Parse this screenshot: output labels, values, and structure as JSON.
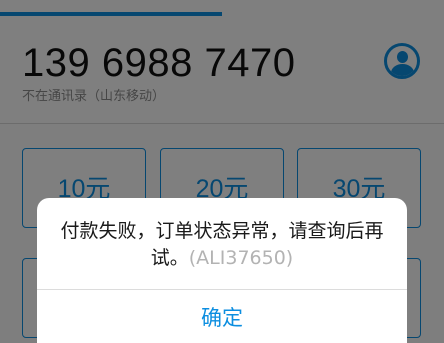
{
  "progress": {
    "fraction": 0.5
  },
  "phone": {
    "number": "139 6988 7470",
    "subtitle": "不在通讯录（山东移动）"
  },
  "contact_button": {
    "icon": "contact-person-icon"
  },
  "amount_options": [
    {
      "label": "10元"
    },
    {
      "label": "20元"
    },
    {
      "label": "30元"
    },
    {
      "label": ""
    },
    {
      "label": ""
    },
    {
      "label": ""
    }
  ],
  "dialog": {
    "message": "付款失败，订单状态异常，请查询后再试。",
    "code": "(ALI37650)",
    "confirm_label": "确定"
  },
  "colors": {
    "accent": "#0c8ee0",
    "overlay": "rgba(0,0,0,0.5)",
    "code_text": "#b3b3b3"
  }
}
